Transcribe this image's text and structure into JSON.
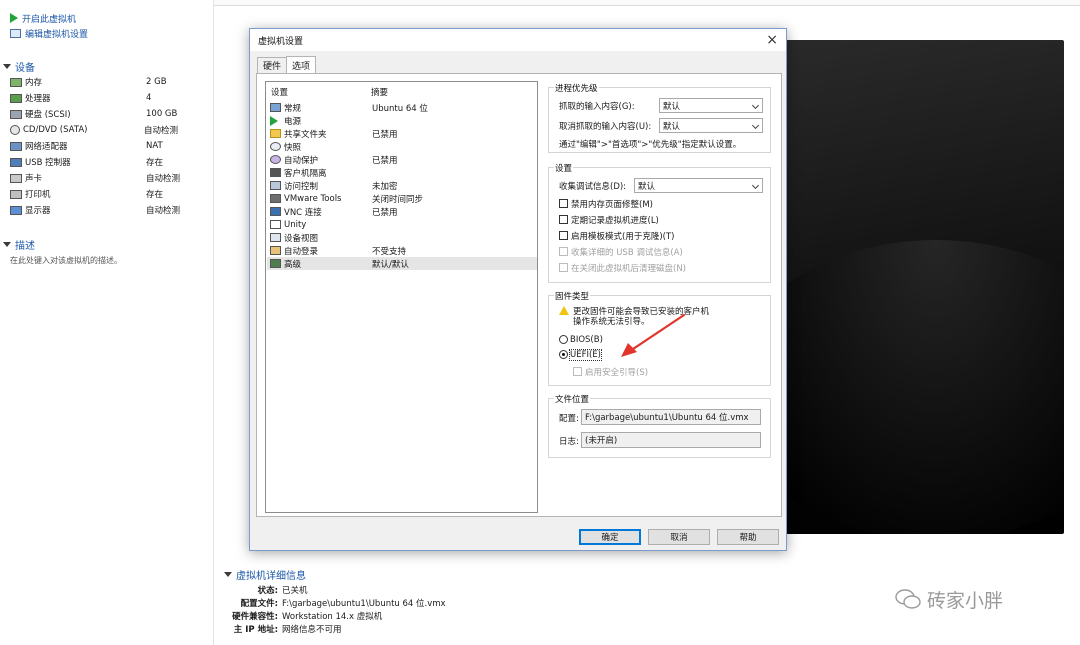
{
  "left_panel": {
    "actions": [
      {
        "label": "开启此虚拟机",
        "icon": "play-icon"
      },
      {
        "label": "编辑虚拟机设置",
        "icon": "edit-settings-icon"
      }
    ],
    "devices_title": "设备",
    "devices": [
      {
        "name": "内存",
        "value": "2 GB",
        "icon": "memory-icon"
      },
      {
        "name": "处理器",
        "value": "4",
        "icon": "cpu-icon"
      },
      {
        "name": "硬盘 (SCSI)",
        "value": "100 GB",
        "icon": "hard-disk-icon"
      },
      {
        "name": "CD/DVD (SATA)",
        "value": "自动检测",
        "icon": "cd-dvd-icon"
      },
      {
        "name": "网络适配器",
        "value": "NAT",
        "icon": "network-adapter-icon"
      },
      {
        "name": "USB 控制器",
        "value": "存在",
        "icon": "usb-icon"
      },
      {
        "name": "声卡",
        "value": "自动检测",
        "icon": "sound-card-icon"
      },
      {
        "name": "打印机",
        "value": "存在",
        "icon": "printer-icon"
      },
      {
        "name": "显示器",
        "value": "自动检测",
        "icon": "display-icon"
      }
    ],
    "description_title": "描述",
    "description_placeholder": "在此处键入对该虚拟机的描述。"
  },
  "details": {
    "title": "虚拟机详细信息",
    "rows": [
      {
        "label": "状态:",
        "value": "已关机"
      },
      {
        "label": "配置文件:",
        "value": "F:\\garbage\\ubuntu1\\Ubuntu 64 位.vmx"
      },
      {
        "label": "硬件兼容性:",
        "value": "Workstation 14.x 虚拟机"
      },
      {
        "label": "主 IP 地址:",
        "value": "网络信息不可用"
      }
    ]
  },
  "dialog": {
    "title": "虚拟机设置",
    "close": "×",
    "tabs": [
      {
        "label": "硬件",
        "active": false
      },
      {
        "label": "选项",
        "active": true
      }
    ],
    "list_headers": {
      "setting": "设置",
      "summary": "摘要"
    },
    "options": [
      {
        "name": "常规",
        "summary": "Ubuntu 64 位",
        "icon": "general-icon"
      },
      {
        "name": "电源",
        "summary": "",
        "icon": "power-icon"
      },
      {
        "name": "共享文件夹",
        "summary": "已禁用",
        "icon": "shared-folder-icon"
      },
      {
        "name": "快照",
        "summary": "",
        "icon": "snapshot-icon"
      },
      {
        "name": "自动保护",
        "summary": "已禁用",
        "icon": "autoprotect-icon"
      },
      {
        "name": "客户机隔离",
        "summary": "",
        "icon": "guest-isolation-icon"
      },
      {
        "name": "访问控制",
        "summary": "未加密",
        "icon": "access-control-icon"
      },
      {
        "name": "VMware Tools",
        "summary": "关闭时间同步",
        "icon": "vmware-tools-icon"
      },
      {
        "name": "VNC 连接",
        "summary": "已禁用",
        "icon": "vnc-icon"
      },
      {
        "name": "Unity",
        "summary": "",
        "icon": "unity-icon"
      },
      {
        "name": "设备视图",
        "summary": "",
        "icon": "device-view-icon"
      },
      {
        "name": "自动登录",
        "summary": "不受支持",
        "icon": "autologin-icon"
      },
      {
        "name": "高级",
        "summary": "默认/默认",
        "icon": "advanced-icon",
        "selected": true
      }
    ],
    "process_priority": {
      "title": "进程优先级",
      "grabbed_label": "抓取的输入内容(G):",
      "grabbed_value": "默认",
      "ungrabbed_label": "取消抓取的输入内容(U):",
      "ungrabbed_value": "默认",
      "note": "通过\"编辑\">\"首选项\">\"优先级\"指定默认设置。"
    },
    "settings": {
      "title": "设置",
      "debug_label": "收集调试信息(D):",
      "debug_value": "默认",
      "checkboxes": [
        {
          "label": "禁用内存页面修整(M)",
          "checked": false,
          "disabled": false
        },
        {
          "label": "定期记录虚拟机进度(L)",
          "checked": false,
          "disabled": false
        },
        {
          "label": "启用模板模式(用于克隆)(T)",
          "checked": false,
          "disabled": false
        },
        {
          "label": "收集详细的 USB 调试信息(A)",
          "checked": false,
          "disabled": true
        },
        {
          "label": "在关闭此虚拟机后清理磁盘(N)",
          "checked": false,
          "disabled": true
        }
      ]
    },
    "firmware": {
      "title": "固件类型",
      "warning_line1": "更改固件可能会导致已安装的客户机",
      "warning_line2": "操作系统无法引导。",
      "bios_label": "BIOS(B)",
      "uefi_label": "UEFI(E)",
      "selected": "UEFI",
      "secure_boot_label": "启用安全引导(S)"
    },
    "file_location": {
      "title": "文件位置",
      "config_label": "配置:",
      "config_value": "F:\\garbage\\ubuntu1\\Ubuntu 64 位.vmx",
      "log_label": "日志:",
      "log_value": "(未开启)"
    },
    "buttons": {
      "ok": "确定",
      "cancel": "取消",
      "help": "帮助"
    }
  },
  "watermark": {
    "text": "砖家小胖"
  },
  "colors": {
    "link": "#1b57a8",
    "arrow": "#e0342c",
    "accent": "#0078d7"
  }
}
